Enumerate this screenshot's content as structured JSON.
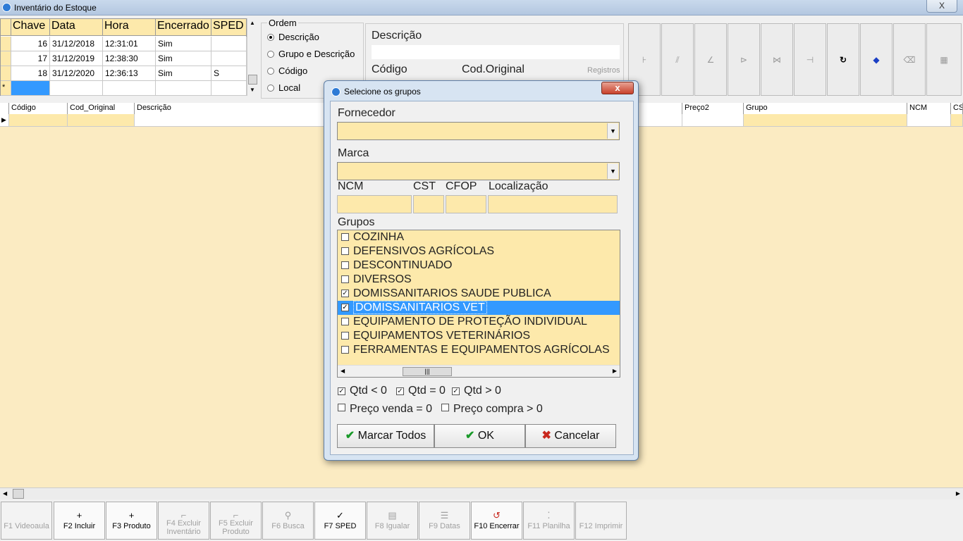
{
  "window": {
    "title": "Inventário do Estoque",
    "close_glyph": "X"
  },
  "inventory_table": {
    "headers": [
      "Chave",
      "Data",
      "Hora",
      "Encerrado",
      "SPED"
    ],
    "rows": [
      {
        "chave": "16",
        "data": "31/12/2018",
        "hora": "12:31:01",
        "encerrado": "Sim",
        "sped": ""
      },
      {
        "chave": "17",
        "data": "31/12/2019",
        "hora": "12:38:30",
        "encerrado": "Sim",
        "sped": ""
      },
      {
        "chave": "18",
        "data": "31/12/2020",
        "hora": "12:36:13",
        "encerrado": "Sim",
        "sped": "S"
      }
    ],
    "new_row_marker": "*"
  },
  "ordem": {
    "legend": "Ordem",
    "options": [
      "Descrição",
      "Grupo e Descrição",
      "Código",
      "Local"
    ],
    "selected": "Descrição"
  },
  "search_panel": {
    "descricao_label": "Descrição",
    "codigo_label": "Código",
    "cod_original_label": "Cod.Original",
    "registros_label": "Registros"
  },
  "grid": {
    "columns_left": [
      "Código",
      "Cod_Original",
      "Descrição"
    ],
    "columns_right": [
      "Preço2",
      "Grupo",
      "NCM",
      "CS"
    ]
  },
  "function_keys": [
    {
      "label": "F1 Videoaula",
      "icon": "",
      "enabled": false
    },
    {
      "label": "F2 Incluir",
      "icon": "+",
      "enabled": true
    },
    {
      "label": "F3 Produto",
      "icon": "+",
      "enabled": true
    },
    {
      "label": "F4 Excluir Inventário",
      "icon": "⌐",
      "enabled": false
    },
    {
      "label": "F5 Excluir Produto",
      "icon": "⌐",
      "enabled": false
    },
    {
      "label": "F6 Busca",
      "icon": "⚲",
      "enabled": false
    },
    {
      "label": "F7 SPED",
      "icon": "✓",
      "enabled": true
    },
    {
      "label": "F8 Igualar",
      "icon": "▤",
      "enabled": false
    },
    {
      "label": "F9 Datas",
      "icon": "☰",
      "enabled": false
    },
    {
      "label": "F10 Encerrar",
      "icon": "↺",
      "enabled": true
    },
    {
      "label": "F11 Planilha",
      "icon": "⁚",
      "enabled": false
    },
    {
      "label": "F12 Imprimir",
      "icon": "",
      "enabled": false
    }
  ],
  "dialog": {
    "title": "Selecione os grupos",
    "close_glyph": "x",
    "fornecedor_label": "Fornecedor",
    "marca_label": "Marca",
    "ncm_label": "NCM",
    "cst_label": "CST",
    "cfop_label": "CFOP",
    "localizacao_label": "Localização",
    "grupos_label": "Grupos",
    "grupos": [
      {
        "name": "COZINHA",
        "checked": false
      },
      {
        "name": "DEFENSIVOS AGRÍCOLAS",
        "checked": false
      },
      {
        "name": "DESCONTINUADO",
        "checked": false
      },
      {
        "name": "DIVERSOS",
        "checked": false
      },
      {
        "name": "DOMISSANITARIOS SAUDE PUBLICA",
        "checked": true
      },
      {
        "name": "DOMISSANITARIOS VET",
        "checked": true,
        "selected": true
      },
      {
        "name": "EQUIPAMENTO DE PROTEÇÃO INDIVIDUAL",
        "checked": false
      },
      {
        "name": "EQUIPAMENTOS VETERINÁRIOS",
        "checked": false
      },
      {
        "name": "FERRAMENTAS E EQUIPAMENTOS AGRÍCOLAS",
        "checked": false
      }
    ],
    "filters": [
      {
        "label": "Qtd < 0",
        "checked": true
      },
      {
        "label": "Qtd = 0",
        "checked": true
      },
      {
        "label": "Qtd > 0",
        "checked": true
      },
      {
        "label": "Preço venda = 0",
        "checked": false
      },
      {
        "label": "Preço compra > 0",
        "checked": false
      }
    ],
    "buttons": {
      "marcar_todos": "Marcar Todos",
      "ok": "OK",
      "cancelar": "Cancelar"
    }
  },
  "colors": {
    "field_bg": "#fde9ab",
    "grid_bg": "#fbebc2",
    "selection": "#3399ff"
  }
}
